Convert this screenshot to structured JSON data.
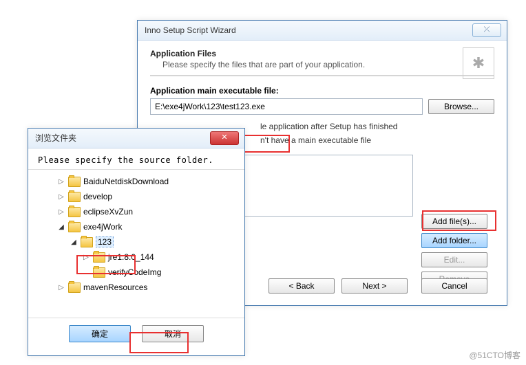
{
  "wizard": {
    "title": "Inno Setup Script Wizard",
    "header": {
      "t": "Application Files",
      "s": "Please specify the files that are part of your application."
    },
    "mainLbl": "Application main executable file:",
    "path": "E:\\exe4jWork\\123\\test123.exe",
    "browse": "Browse...",
    "line1": "le application after Setup has finished",
    "line2": "n't have a main executable file",
    "btns": {
      "add": "Add file(s)...",
      "folder": "Add folder...",
      "edit": "Edit...",
      "remove": "Remove"
    },
    "nav": {
      "back": "< Back",
      "next": "Next >",
      "cancel": "Cancel"
    },
    "star": "✱"
  },
  "browser": {
    "title": "浏览文件夹",
    "msg": "Please specify the source folder.",
    "ok": "确定",
    "cancel": "取消",
    "nodes": [
      {
        "indent": 28,
        "arrow": "▷",
        "label": "BaiduNetdiskDownload"
      },
      {
        "indent": 28,
        "arrow": "▷",
        "label": "develop"
      },
      {
        "indent": 28,
        "arrow": "▷",
        "label": "eclipseXvZun"
      },
      {
        "indent": 28,
        "arrow": "◢",
        "label": "exe4jWork",
        "open": true
      },
      {
        "indent": 46,
        "arrow": "◢",
        "label": "123",
        "open": true,
        "sel": true
      },
      {
        "indent": 64,
        "arrow": "▷",
        "label": "jre1.8.0_144"
      },
      {
        "indent": 64,
        "arrow": "",
        "label": "verifyCodeImg"
      },
      {
        "indent": 28,
        "arrow": "▷",
        "label": "mavenResources"
      }
    ]
  },
  "watermark": "@51CTO博客"
}
